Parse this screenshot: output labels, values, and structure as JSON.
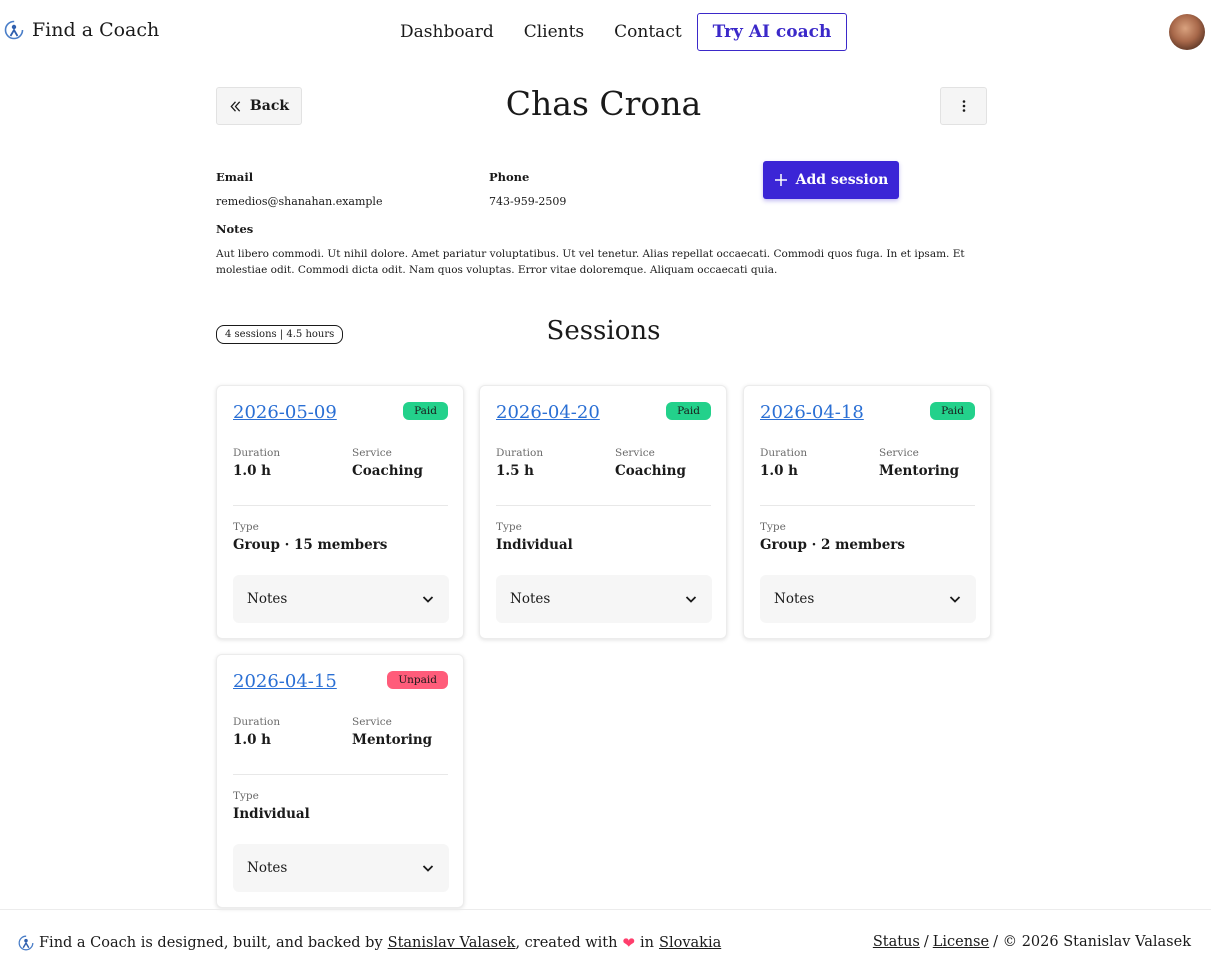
{
  "header": {
    "brand_name": "Find a Coach",
    "brand_icon": "coach-logo-icon",
    "nav": {
      "dashboard": "Dashboard",
      "clients": "Clients",
      "contact": "Contact",
      "ai_coach": "Try AI coach"
    },
    "accent_color": "#3b29c9"
  },
  "client": {
    "back_label": "Back",
    "name": "Chas Crona",
    "email_label": "Email",
    "email": "remedios@shanahan.example",
    "phone_label": "Phone",
    "phone": "743-959-2509",
    "add_session_label": "Add session",
    "notes_label": "Notes",
    "notes": "Aut libero commodi. Ut nihil dolore. Amet pariatur voluptatibus. Ut vel tenetur. Alias repellat occaecati. Commodi quos fuga. In et ipsam. Et molestiae odit. Commodi dicta odit. Nam quos voluptas. Error vitae doloremque. Aliquam occaecati quia."
  },
  "sessions": {
    "summary": "4 sessions | 4.5 hours",
    "title": "Sessions",
    "labels": {
      "duration": "Duration",
      "service": "Service",
      "type": "Type",
      "notes": "Notes"
    },
    "items": [
      {
        "date": "2026-05-09",
        "status": "Paid",
        "duration": "1.0 h",
        "service": "Coaching",
        "type": "Group · 15 members"
      },
      {
        "date": "2026-04-20",
        "status": "Paid",
        "duration": "1.5 h",
        "service": "Coaching",
        "type": "Individual"
      },
      {
        "date": "2026-04-18",
        "status": "Paid",
        "duration": "1.0 h",
        "service": "Mentoring",
        "type": "Group · 2 members"
      },
      {
        "date": "2026-04-15",
        "status": "Unpaid",
        "duration": "1.0 h",
        "service": "Mentoring",
        "type": "Individual"
      }
    ]
  },
  "footer": {
    "text_1": "Find a Coach is designed, built, and backed by",
    "author": "Stanislav Valasek",
    "text_2": ", created with",
    "text_3": "in",
    "country": "Slovakia",
    "status": "Status",
    "sep": "/",
    "license": "License",
    "copyright": "/ © 2026 Stanislav Valasek"
  }
}
